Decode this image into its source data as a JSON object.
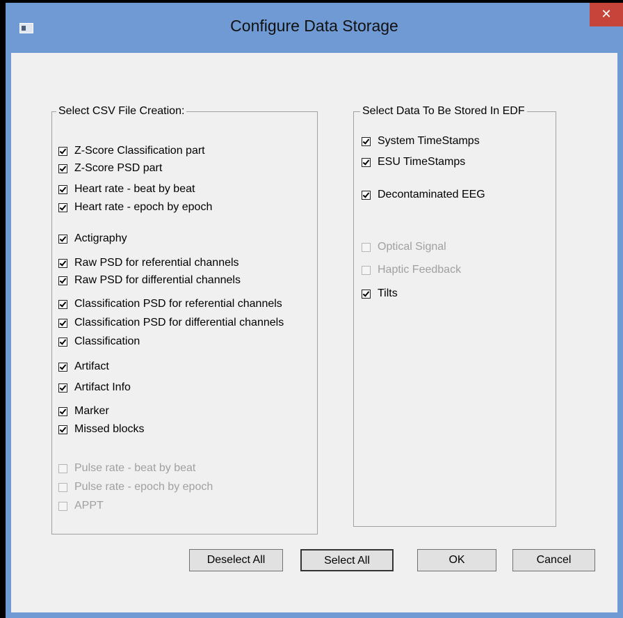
{
  "window": {
    "title": "Configure Data Storage",
    "close_glyph": "✕"
  },
  "csv_group": {
    "legend": "Select CSV File Creation:",
    "items": [
      {
        "label": "Z-Score Classification part",
        "checked": true,
        "enabled": true
      },
      {
        "label": "Z-Score PSD part",
        "checked": true,
        "enabled": true
      },
      {
        "label": "Heart rate - beat by beat",
        "checked": true,
        "enabled": true
      },
      {
        "label": "Heart rate - epoch by epoch",
        "checked": true,
        "enabled": true
      },
      {
        "label": "Actigraphy",
        "checked": true,
        "enabled": true
      },
      {
        "label": "Raw PSD for referential channels",
        "checked": true,
        "enabled": true
      },
      {
        "label": "Raw PSD for differential channels",
        "checked": true,
        "enabled": true
      },
      {
        "label": "Classification PSD for referential channels",
        "checked": true,
        "enabled": true
      },
      {
        "label": "Classification PSD for differential channels",
        "checked": true,
        "enabled": true
      },
      {
        "label": "Classification",
        "checked": true,
        "enabled": true
      },
      {
        "label": "Artifact",
        "checked": true,
        "enabled": true
      },
      {
        "label": "Artifact Info",
        "checked": true,
        "enabled": true
      },
      {
        "label": "Marker",
        "checked": true,
        "enabled": true
      },
      {
        "label": "Missed blocks",
        "checked": true,
        "enabled": true
      },
      {
        "label": "Pulse rate - beat by beat",
        "checked": false,
        "enabled": false
      },
      {
        "label": "Pulse rate - epoch by epoch",
        "checked": false,
        "enabled": false
      },
      {
        "label": "APPT",
        "checked": false,
        "enabled": false
      }
    ]
  },
  "edf_group": {
    "legend": "Select Data To Be Stored In EDF",
    "items": [
      {
        "label": "System TimeStamps",
        "checked": true,
        "enabled": true
      },
      {
        "label": "ESU TimeStamps",
        "checked": true,
        "enabled": true
      },
      {
        "label": "Decontaminated EEG",
        "checked": true,
        "enabled": true
      },
      {
        "label": "Optical Signal",
        "checked": false,
        "enabled": false
      },
      {
        "label": "Haptic Feedback",
        "checked": false,
        "enabled": false
      },
      {
        "label": "Tilts",
        "checked": true,
        "enabled": true
      }
    ]
  },
  "buttons": {
    "deselect_all": "Deselect All",
    "select_all": "Select All",
    "ok": "OK",
    "cancel": "Cancel"
  }
}
